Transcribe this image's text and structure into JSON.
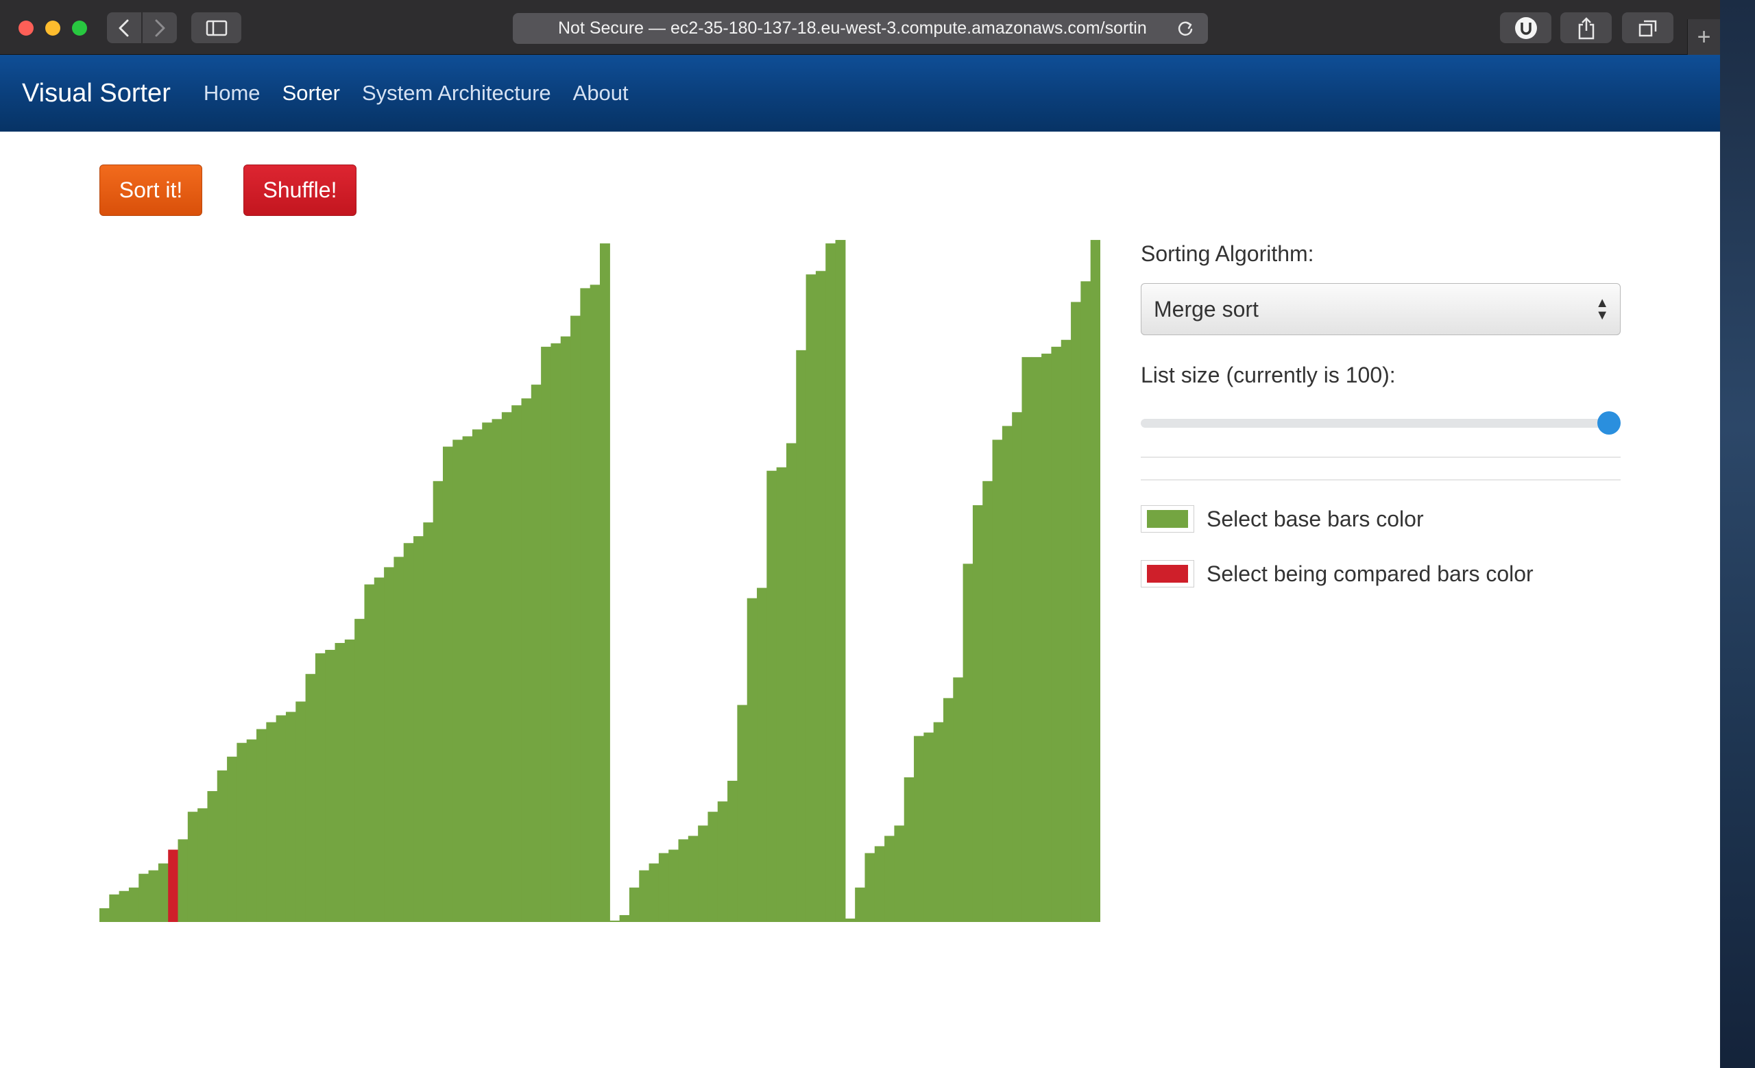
{
  "browser": {
    "address": "Not Secure — ec2-35-180-137-18.eu-west-3.compute.amazonaws.com/sortin",
    "icons": [
      "back-icon",
      "forward-icon",
      "sidebar-icon",
      "reload-icon",
      "extension-icon",
      "share-icon",
      "tabs-icon",
      "plus-icon"
    ]
  },
  "navbar": {
    "brand": "Visual Sorter",
    "links": [
      "Home",
      "Sorter",
      "System Architecture",
      "About"
    ],
    "active": "Sorter"
  },
  "actions": {
    "sort_label": "Sort it!",
    "shuffle_label": "Shuffle!"
  },
  "controls": {
    "algorithm_label": "Sorting Algorithm:",
    "algorithm_value": "Merge sort",
    "size_label": "List size (currently is 100):",
    "size_value_fraction": 1.0,
    "base_color_label": "Select base bars color",
    "compare_color_label": "Select being compared bars color"
  },
  "colors": {
    "base_bar": "#74a541",
    "compared_bar": "#cf1f2a",
    "navbar": "#0b4282",
    "slider_thumb": "#2a8fde"
  },
  "chart_data": {
    "type": "bar",
    "ylim": [
      0,
      100
    ],
    "compared_index": 7,
    "values": [
      2,
      4,
      4.5,
      5,
      7,
      7.5,
      8.5,
      10.5,
      12,
      16,
      16.5,
      19,
      22,
      24,
      26,
      26.5,
      28,
      29,
      30,
      30.5,
      32,
      36,
      39,
      39.5,
      40.5,
      41,
      44,
      49,
      50,
      51.5,
      53,
      55,
      56,
      58,
      64,
      69,
      70,
      70.5,
      71.5,
      72.5,
      73,
      74,
      75,
      76,
      78,
      83.5,
      84,
      85,
      88,
      92,
      92.5,
      98.5,
      0,
      1,
      5,
      7.5,
      8.5,
      10,
      10.5,
      12,
      12.5,
      14,
      16,
      17.5,
      20.5,
      31.5,
      47,
      48.5,
      65.5,
      66,
      69.5,
      83,
      94,
      94.5,
      98.5,
      99,
      0.5,
      5,
      10,
      11,
      12.5,
      14,
      21,
      27,
      27.5,
      29,
      32.5,
      35.5,
      52,
      60.5,
      64,
      70,
      72,
      74,
      82,
      82,
      82.5,
      83.5,
      84.5,
      90,
      93,
      99
    ]
  }
}
